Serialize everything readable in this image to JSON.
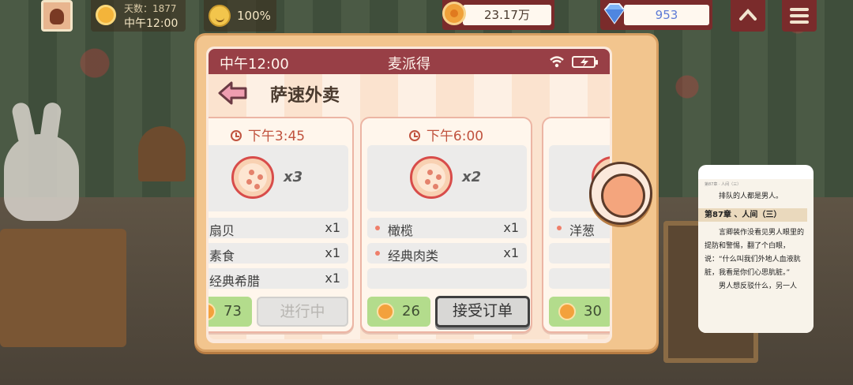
{
  "hud": {
    "days_label": "天数：1877",
    "clock": "中午12:00",
    "mood": "100%",
    "coins": "23.17万",
    "gems": "953"
  },
  "phone": {
    "status_time": "中午12:00",
    "status_title": "麦派得",
    "app_title": "萨速外卖",
    "orders": [
      {
        "time": "下午3:45",
        "pizza_qty": "x3",
        "ingredients": [
          {
            "name": "扇贝",
            "qty": "x1"
          },
          {
            "name": "素食",
            "qty": "x1"
          },
          {
            "name": "经典希腊",
            "qty": "x1"
          }
        ],
        "reward": "73",
        "action": "进行中"
      },
      {
        "time": "下午6:00",
        "pizza_qty": "x2",
        "ingredients": [
          {
            "name": "橄榄",
            "qty": "x1"
          },
          {
            "name": "经典肉类",
            "qty": "x1"
          }
        ],
        "reward": "26",
        "action": "接受订单"
      },
      {
        "time": "下",
        "pizza_qty": "",
        "ingredients": [
          {
            "name": "洋葱",
            "qty": ""
          }
        ],
        "reward": "30",
        "action": ""
      }
    ]
  },
  "reader": {
    "meta": "第87章 · 人间（三）",
    "line1": "排队的人都是男人。",
    "chapter": "第87章 、人间（三）",
    "para1": "言卿装作没看见男人眼里的提防和警惕，翻了个白眼，说：“什么叫我们外地人血液肮脏，我看是你们心思肮脏。”",
    "para2": "男人想反驳什么，另一人"
  },
  "colors": {
    "status_bar": "#983f46",
    "card_time": "#c0533f",
    "reward_green": "#b3dc8c",
    "device_frame": "#f2c58e"
  }
}
